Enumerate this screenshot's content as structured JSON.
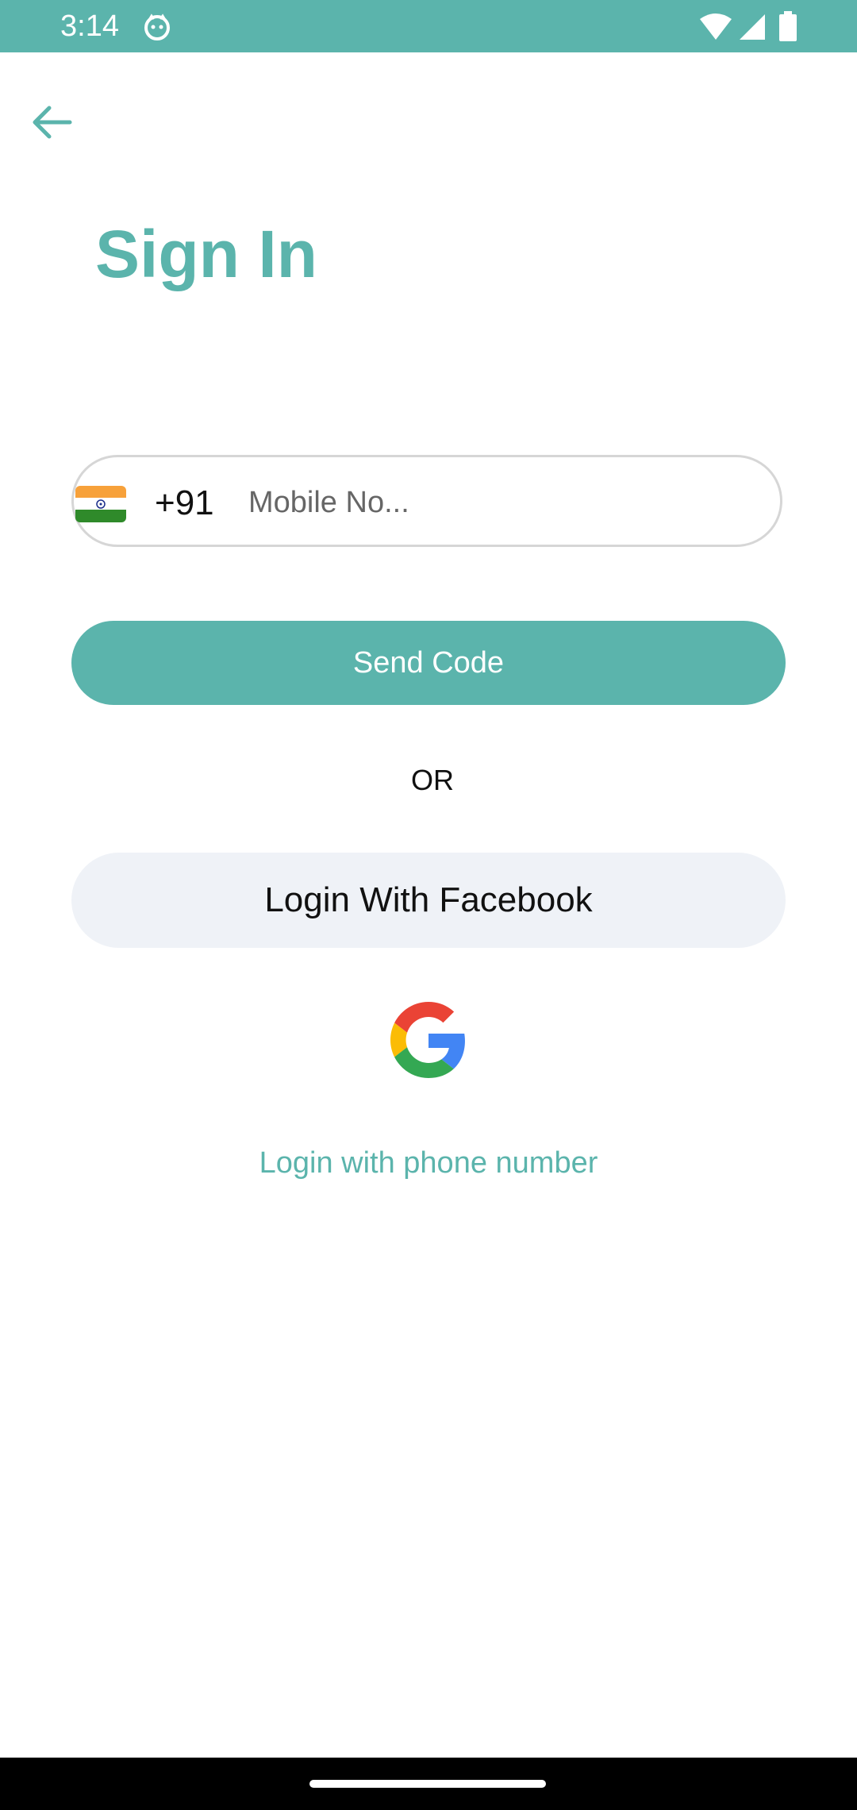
{
  "status_bar": {
    "time": "3:14",
    "background": "#5bb4ac",
    "icons": [
      "cat-notification-icon",
      "wifi-icon",
      "cellular-signal-icon",
      "battery-icon"
    ]
  },
  "header": {
    "back_icon": "arrow-left-icon",
    "title": "Sign In"
  },
  "phone_field": {
    "flag_icon": "india-flag-icon",
    "country_code": "+91",
    "placeholder": "Mobile No...",
    "value": ""
  },
  "send_code": {
    "label": "Send Code"
  },
  "divider": {
    "label": "OR"
  },
  "facebook": {
    "label": "Login With Facebook"
  },
  "google": {
    "icon": "google-logo-icon"
  },
  "phone_login": {
    "label": "Login with phone number"
  },
  "colors": {
    "accent": "#5bb4ac",
    "facebook_bg": "#eff2f7",
    "text": "#111111"
  }
}
